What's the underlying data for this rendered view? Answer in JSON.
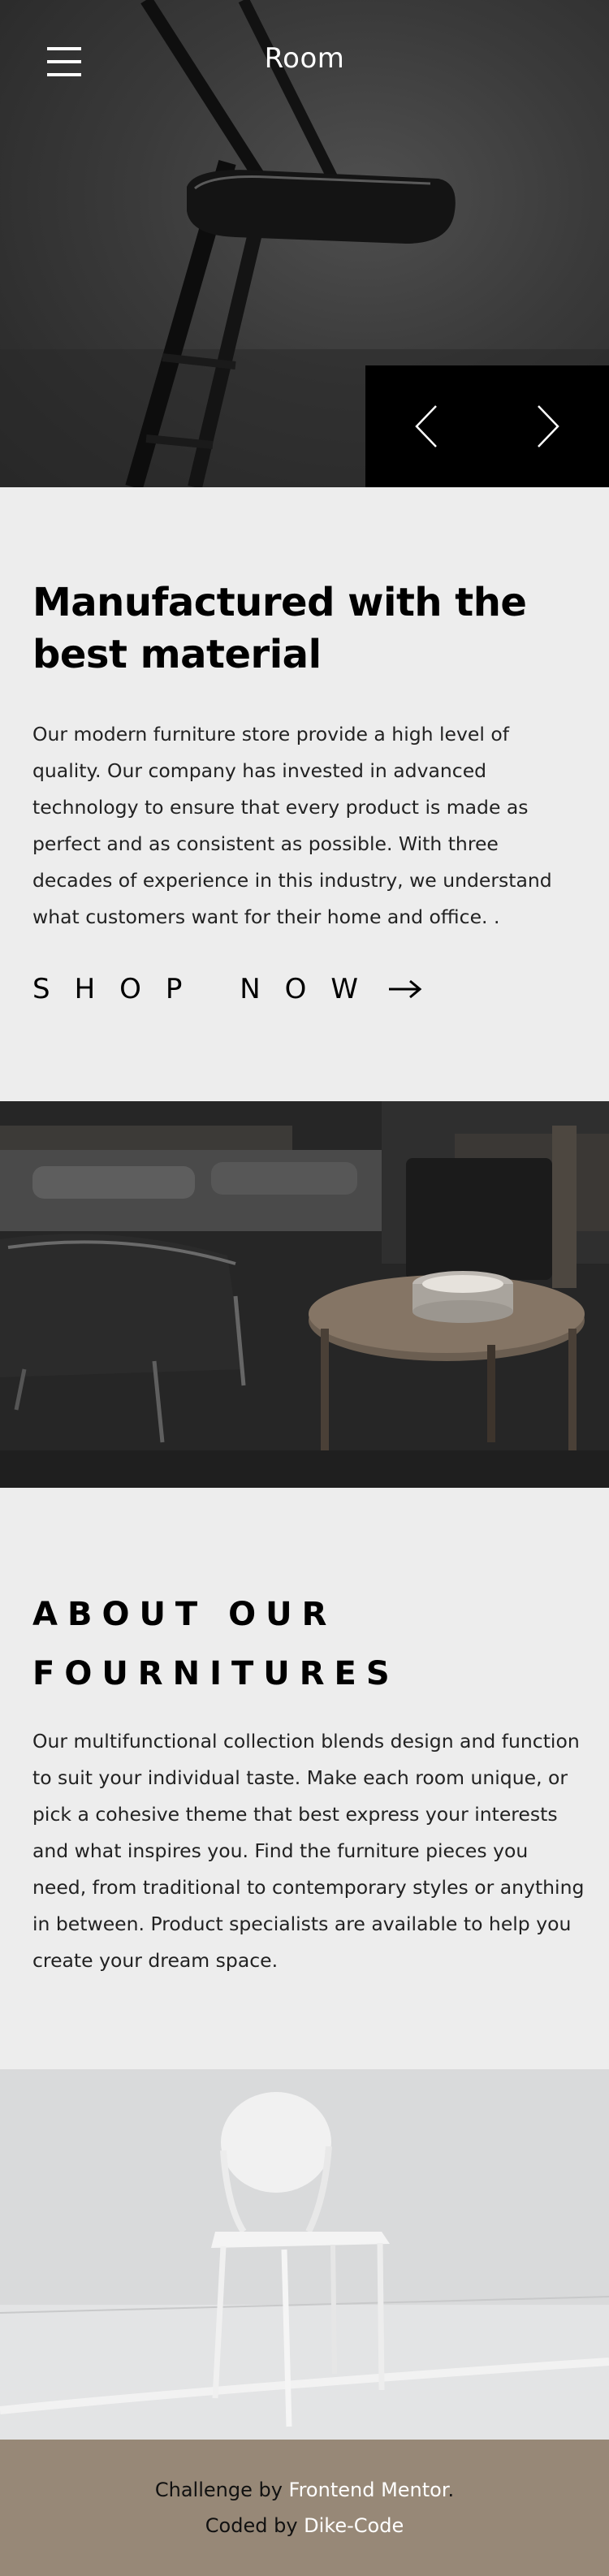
{
  "header": {
    "logo": "Room",
    "menu_icon": "hamburger-menu-icon",
    "prev_icon": "chevron-left-icon",
    "next_icon": "chevron-right-icon"
  },
  "intro": {
    "title": "Manufactured with the best material",
    "body": "Our modern furniture store provide a high level of quality. Our company has invested in advanced technology to ensure that every product is made as perfect and as consistent as possible. With three decades of experience in this industry, we understand what customers want for their home and office. .",
    "cta_label": "SHOP NOW",
    "cta_icon": "arrow-right-icon"
  },
  "about": {
    "title": "ABOUT OUR FOURNITURES",
    "body": "Our multifunctional collection blends design and function to suit your individual taste. Make each room unique, or pick a cohesive theme that best express your interests and what inspires you. Find the furniture pieces you need, from traditional to contemporary styles or anything in between. Product specialists are available to help you create your dream space."
  },
  "footer": {
    "challenge_prefix": "Challenge by ",
    "challenge_link": "Frontend Mentor",
    "challenge_suffix": ".",
    "coded_prefix": "Coded by ",
    "coded_link": "Dike-Code"
  },
  "colors": {
    "background": "#ededed",
    "footer_bg": "#978877",
    "nav_bg": "#000000",
    "link": "#ffffff"
  }
}
